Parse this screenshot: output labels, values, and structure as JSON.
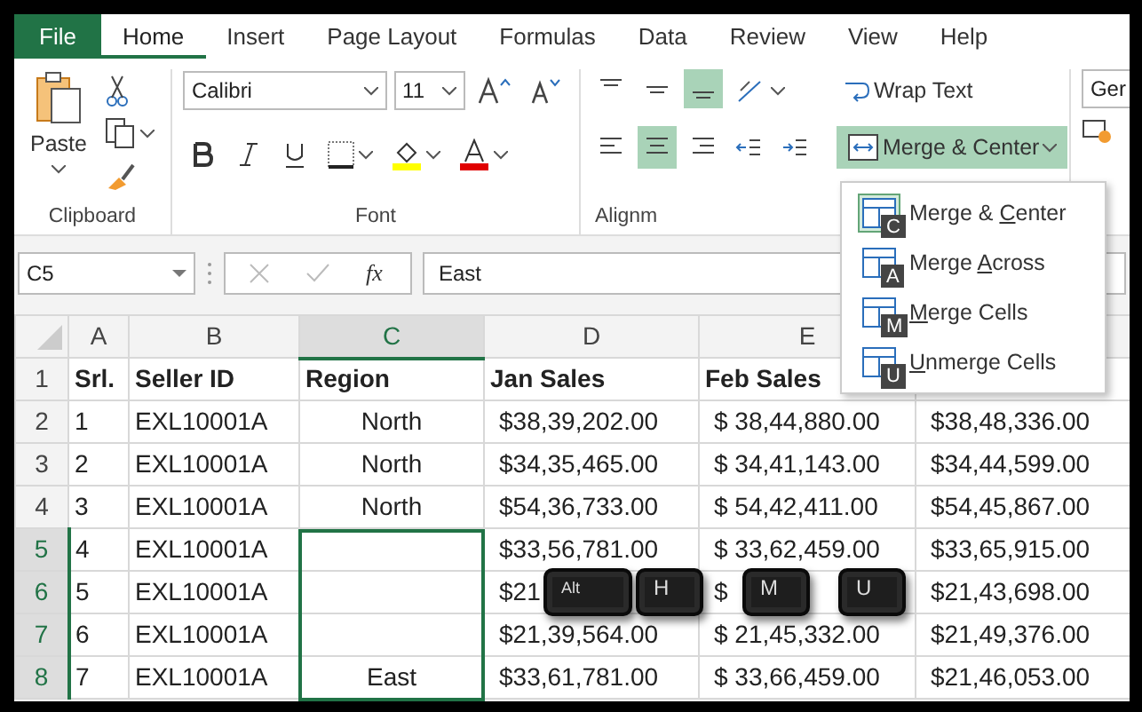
{
  "tabs": [
    {
      "label": "File",
      "kind": "file",
      "selected": false
    },
    {
      "label": "Home",
      "kind": "tab",
      "selected": true
    },
    {
      "label": "Insert",
      "kind": "tab",
      "selected": false
    },
    {
      "label": "Page Layout",
      "kind": "tab",
      "selected": false
    },
    {
      "label": "Formulas",
      "kind": "tab",
      "selected": false
    },
    {
      "label": "Data",
      "kind": "tab",
      "selected": false
    },
    {
      "label": "Review",
      "kind": "tab",
      "selected": false
    },
    {
      "label": "View",
      "kind": "tab",
      "selected": false
    },
    {
      "label": "Help",
      "kind": "tab",
      "selected": false
    }
  ],
  "clipboard": {
    "paste": "Paste",
    "group_label": "Clipboard"
  },
  "font": {
    "name": "Calibri",
    "size": "11",
    "group_label": "Font"
  },
  "alignment": {
    "vertical": [
      {
        "selected": false
      },
      {
        "selected": false
      },
      {
        "selected": true
      }
    ],
    "horizontal": [
      {
        "selected": false
      },
      {
        "selected": true
      },
      {
        "selected": false
      }
    ],
    "wrap_text": "Wrap Text",
    "merge": {
      "label": "Merge & Center",
      "selected": true
    },
    "group_label": "Alignm"
  },
  "number": {
    "format": "Ger"
  },
  "merge_menu": [
    {
      "before": "Merge & ",
      "accel": "C",
      "after": "enter",
      "keytip": "C",
      "selected": true
    },
    {
      "before": "Merge ",
      "accel": "A",
      "after": "cross",
      "keytip": "A",
      "selected": false
    },
    {
      "accel": "M",
      "after": "erge Cells",
      "keytip": "M",
      "selected": false
    },
    {
      "accel": "U",
      "after": "nmerge Cells",
      "keytip": "U",
      "selected": false
    }
  ],
  "formula_bar": {
    "name_box": "C5",
    "fx": "fx",
    "value": "East"
  },
  "sheet": {
    "columns": [
      {
        "letter": "A",
        "selected": false
      },
      {
        "letter": "B",
        "selected": false
      },
      {
        "letter": "C",
        "selected": true
      },
      {
        "letter": "D",
        "selected": false
      },
      {
        "letter": "E",
        "selected": false
      }
    ],
    "header_row": {
      "num": "1",
      "cells": [
        "Srl.",
        "Seller ID",
        "Region",
        "Jan Sales",
        "Feb Sales"
      ]
    },
    "rows": [
      {
        "num": "2",
        "selected": false,
        "srl": "1",
        "seller_id": "EXL10001A",
        "region": "North",
        "jan": "$38,39,202.00",
        "feb": "$ 38,44,880.00",
        "mar": "$38,48,336.00"
      },
      {
        "num": "3",
        "selected": false,
        "srl": "2",
        "seller_id": "EXL10001A",
        "region": "North",
        "jan": "$34,35,465.00",
        "feb": "$ 34,41,143.00",
        "mar": "$34,44,599.00"
      },
      {
        "num": "4",
        "selected": false,
        "srl": "3",
        "seller_id": "EXL10001A",
        "region": "North",
        "jan": "$54,36,733.00",
        "feb": "$ 54,42,411.00",
        "mar": "$54,45,867.00"
      },
      {
        "num": "5",
        "selected": true,
        "srl": "4",
        "seller_id": "EXL10001A",
        "jan": "$33,56,781.00",
        "feb": "$ 33,62,459.00",
        "mar": "$33,65,915.00"
      },
      {
        "num": "6",
        "selected": true,
        "srl": "5",
        "seller_id": "EXL10001A",
        "jan": "$21",
        "feb": "$",
        "mar": "$21,43,698.00"
      },
      {
        "num": "7",
        "selected": true,
        "srl": "6",
        "seller_id": "EXL10001A",
        "jan": "$21,39,564.00",
        "feb": "$ 21,45,332.00",
        "mar": "$21,49,376.00"
      },
      {
        "num": "8",
        "selected": true,
        "srl": "7",
        "seller_id": "EXL10001A",
        "region": "East",
        "jan": "$33,61,781.00",
        "feb": "$ 33,66,459.00",
        "mar": "$21,46,053.00"
      }
    ]
  },
  "keys": [
    "Alt",
    "H",
    "M",
    "U"
  ]
}
